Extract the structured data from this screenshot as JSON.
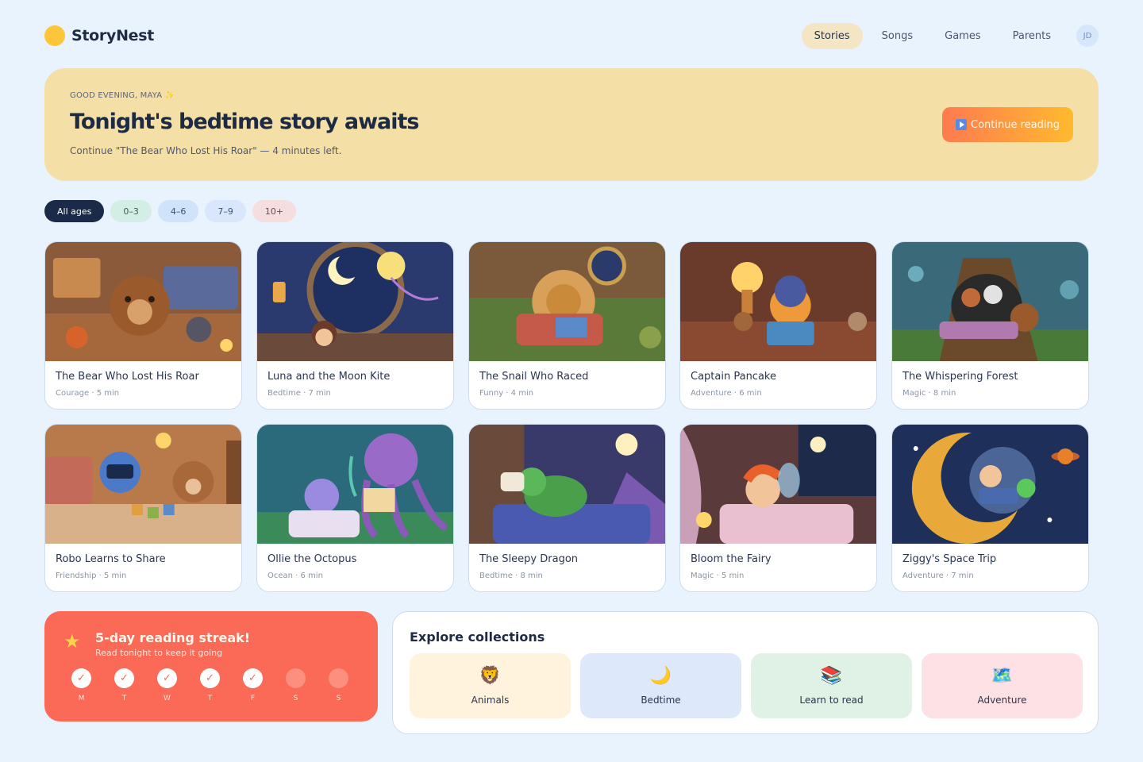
{
  "app": {
    "name": "StoryNest"
  },
  "nav": {
    "items": [
      {
        "label": "Stories",
        "active": true
      },
      {
        "label": "Songs"
      },
      {
        "label": "Games"
      },
      {
        "label": "Parents"
      }
    ],
    "avatar_initials": "JD"
  },
  "hero": {
    "eyebrow": "GOOD EVENING, MAYA ✨",
    "title": "Tonight's bedtime story awaits",
    "subtitle": "Continue \"The Bear Who Lost His Roar\" — 4 minutes left.",
    "button_label": "Continue reading",
    "button_icon": "play-icon"
  },
  "filters": [
    "All ages",
    "0–3",
    "4–6",
    "7–9",
    "10+"
  ],
  "stories": [
    {
      "title": "The Bear Who Lost His Roar",
      "meta": "Courage · 5 min"
    },
    {
      "title": "Luna and the Moon Kite",
      "meta": "Bedtime · 7 min"
    },
    {
      "title": "The Snail Who Raced",
      "meta": "Funny · 4 min"
    },
    {
      "title": "Captain Pancake",
      "meta": "Adventure · 6 min"
    },
    {
      "title": "The Whispering Forest",
      "meta": "Magic · 8 min"
    },
    {
      "title": "Robo Learns to Share",
      "meta": "Friendship · 5 min"
    },
    {
      "title": "Ollie the Octopus",
      "meta": "Ocean · 6 min"
    },
    {
      "title": "The Sleepy Dragon",
      "meta": "Bedtime · 8 min"
    },
    {
      "title": "Bloom the Fairy",
      "meta": "Magic · 5 min"
    },
    {
      "title": "Ziggy's Space Trip",
      "meta": "Adventure · 7 min"
    }
  ],
  "streak": {
    "title": "5-day reading streak!",
    "subtitle": "Read tonight to keep it going",
    "days": [
      {
        "label": "M",
        "done": true
      },
      {
        "label": "T",
        "done": true
      },
      {
        "label": "W",
        "done": true
      },
      {
        "label": "T",
        "done": true
      },
      {
        "label": "F",
        "done": true
      },
      {
        "label": "S",
        "done": false
      },
      {
        "label": "S",
        "done": false
      }
    ]
  },
  "collections": {
    "title": "Explore collections",
    "items": [
      {
        "label": "Animals",
        "icon": "lion-icon",
        "glyph": "🦁",
        "bg": "#fff3dd"
      },
      {
        "label": "Bedtime",
        "icon": "moon-icon",
        "glyph": "🌙",
        "bg": "#dde9fb"
      },
      {
        "label": "Learn to read",
        "icon": "books-icon",
        "glyph": "📚",
        "bg": "#e0f1e5"
      },
      {
        "label": "Adventure",
        "icon": "map-icon",
        "glyph": "🗺️",
        "bg": "#fde1e4"
      }
    ]
  }
}
